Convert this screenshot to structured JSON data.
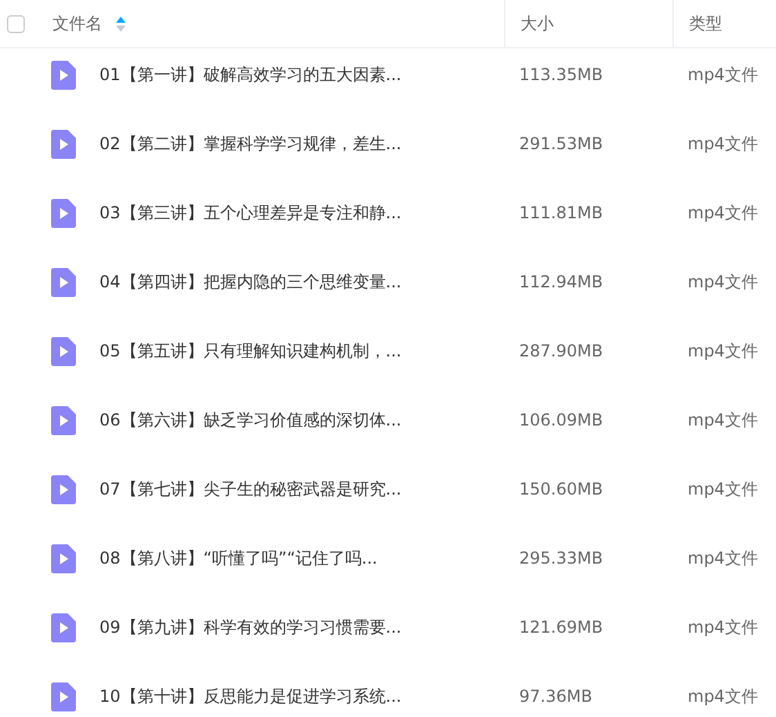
{
  "header": {
    "select_all_checked": false,
    "columns": [
      {
        "label": "文件名",
        "sorted": true
      },
      {
        "label": "大小",
        "sorted": false
      },
      {
        "label": "类型",
        "sorted": false
      }
    ]
  },
  "files": [
    {
      "name": "01【第一讲】破解高效学习的五大因素...",
      "size": "113.35MB",
      "type": "mp4文件"
    },
    {
      "name": "02【第二讲】掌握科学学习规律，差生...",
      "size": "291.53MB",
      "type": "mp4文件"
    },
    {
      "name": "03【第三讲】五个心理差异是专注和静...",
      "size": "111.81MB",
      "type": "mp4文件"
    },
    {
      "name": "04【第四讲】把握内隐的三个思维变量...",
      "size": "112.94MB",
      "type": "mp4文件"
    },
    {
      "name": "05【第五讲】只有理解知识建构机制，...",
      "size": "287.90MB",
      "type": "mp4文件"
    },
    {
      "name": "06【第六讲】缺乏学习价值感的深切体...",
      "size": "106.09MB",
      "type": "mp4文件"
    },
    {
      "name": "07【第七讲】尖子生的秘密武器是研究...",
      "size": "150.60MB",
      "type": "mp4文件"
    },
    {
      "name": "08【第八讲】“听懂了吗”“记住了吗...",
      "size": "295.33MB",
      "type": "mp4文件"
    },
    {
      "name": "09【第九讲】科学有效的学习习惯需要...",
      "size": "121.69MB",
      "type": "mp4文件"
    },
    {
      "name": "10【第十讲】反思能力是促进学习系统...",
      "size": "97.36MB",
      "type": "mp4文件"
    }
  ]
}
